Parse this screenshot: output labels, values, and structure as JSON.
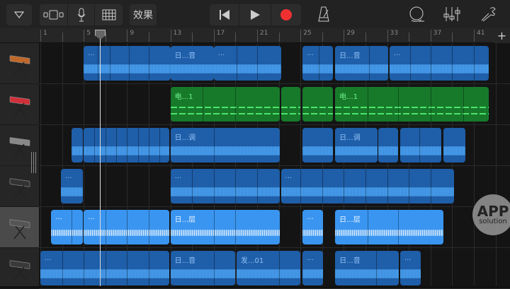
{
  "toolbar": {
    "effects_label": "效果",
    "icons": [
      "triangle-down-icon",
      "view-toggle-icon",
      "microphone-icon",
      "grid-icon",
      "rewind-icon",
      "play-icon",
      "record-icon",
      "metronome-icon",
      "loop-icon",
      "mixer-icon",
      "wrench-icon"
    ],
    "record_color": "#f03030"
  },
  "ruler": {
    "labels": [
      "1",
      "5",
      "9",
      "13",
      "17",
      "21",
      "25",
      "29",
      "33",
      "37",
      "41"
    ],
    "add_label": "+"
  },
  "playhead_bar": 6.5,
  "tracks": [
    {
      "instrument": "synth-orange",
      "regions": [
        {
          "start": 5,
          "end": 13,
          "label": "...",
          "seps": [
            6.3,
            7.4,
            9.2,
            11
          ]
        },
        {
          "start": 13,
          "end": 17,
          "label": "日...音",
          "seps": []
        },
        {
          "start": 17,
          "end": 23.2,
          "label": "...",
          "seps": [
            19.1,
            21
          ]
        },
        {
          "start": 25.2,
          "end": 28,
          "label": "...",
          "seps": [
            26.7
          ]
        },
        {
          "start": 28.2,
          "end": 33.1,
          "label": "日...音",
          "seps": [
            31.3
          ]
        },
        {
          "start": 33.2,
          "end": 42.4,
          "label": "...",
          "seps": [
            35.1,
            37,
            39,
            41
          ]
        }
      ],
      "style": "blue"
    },
    {
      "instrument": "keyboard-red",
      "regions": [
        {
          "start": 13,
          "end": 23.1,
          "label": "电...1",
          "seps": [
            16,
            19
          ]
        },
        {
          "start": 23.2,
          "end": 25,
          "label": "",
          "seps": []
        },
        {
          "start": 25.2,
          "end": 28,
          "label": "",
          "seps": []
        },
        {
          "start": 28.2,
          "end": 42.4,
          "label": "电...1",
          "seps": [
            31.2,
            34,
            37,
            40
          ]
        }
      ],
      "style": "green"
    },
    {
      "instrument": "synth-grey",
      "regions": [
        {
          "start": 3.9,
          "end": 4.9,
          "label": "",
          "seps": []
        },
        {
          "start": 5,
          "end": 12.9,
          "label": "",
          "seps": [
            6,
            7,
            8,
            9,
            10,
            11,
            12
          ]
        },
        {
          "start": 13,
          "end": 23.1,
          "label": "日...调",
          "seps": [
            17
          ]
        },
        {
          "start": 25.2,
          "end": 28,
          "label": "",
          "seps": []
        },
        {
          "start": 28.2,
          "end": 32.1,
          "label": "日...调",
          "seps": []
        },
        {
          "start": 32.2,
          "end": 34,
          "label": "",
          "seps": []
        },
        {
          "start": 34.2,
          "end": 38,
          "label": "",
          "seps": [
            36
          ]
        },
        {
          "start": 38.2,
          "end": 40.2,
          "label": "",
          "seps": []
        }
      ],
      "style": "blue"
    },
    {
      "instrument": "keyboard-black",
      "regions": [
        {
          "start": 2.9,
          "end": 4.9,
          "label": "...",
          "seps": []
        },
        {
          "start": 13,
          "end": 23.1,
          "label": "...",
          "seps": [
            15,
            17,
            19,
            21
          ]
        },
        {
          "start": 23.2,
          "end": 39.2,
          "label": "...",
          "seps": [
            25,
            27,
            29,
            31,
            33,
            35,
            37
          ]
        }
      ],
      "style": "blue"
    },
    {
      "instrument": "workstation",
      "selected": true,
      "regions": [
        {
          "start": 2,
          "end": 4.9,
          "label": "...",
          "seps": [
            3.9
          ]
        },
        {
          "start": 5,
          "end": 12.9,
          "label": "...",
          "seps": [
            7,
            9,
            11
          ]
        },
        {
          "start": 13,
          "end": 23.1,
          "label": "日...层",
          "seps": [
            17,
            19
          ]
        },
        {
          "start": 25.2,
          "end": 27.1,
          "label": "...",
          "seps": []
        },
        {
          "start": 28.2,
          "end": 38.2,
          "label": "日...层",
          "seps": [
            31.2,
            34
          ]
        }
      ],
      "style": "bright"
    },
    {
      "instrument": "organ",
      "regions": [
        {
          "start": 1,
          "end": 12.9,
          "label": "...",
          "seps": [
            3,
            5,
            7,
            9,
            11
          ]
        },
        {
          "start": 13,
          "end": 19,
          "label": "日...音",
          "seps": [
            17
          ]
        },
        {
          "start": 19.1,
          "end": 25,
          "label": "发...01",
          "seps": [
            23
          ]
        },
        {
          "start": 25.2,
          "end": 27.1,
          "label": "...",
          "seps": []
        },
        {
          "start": 28.2,
          "end": 34.1,
          "label": "日...音",
          "seps": [
            32
          ]
        },
        {
          "start": 34.2,
          "end": 36.1,
          "label": "...",
          "seps": []
        }
      ],
      "style": "blue"
    }
  ],
  "watermark": {
    "line1": "APP",
    "line2": "solution"
  }
}
